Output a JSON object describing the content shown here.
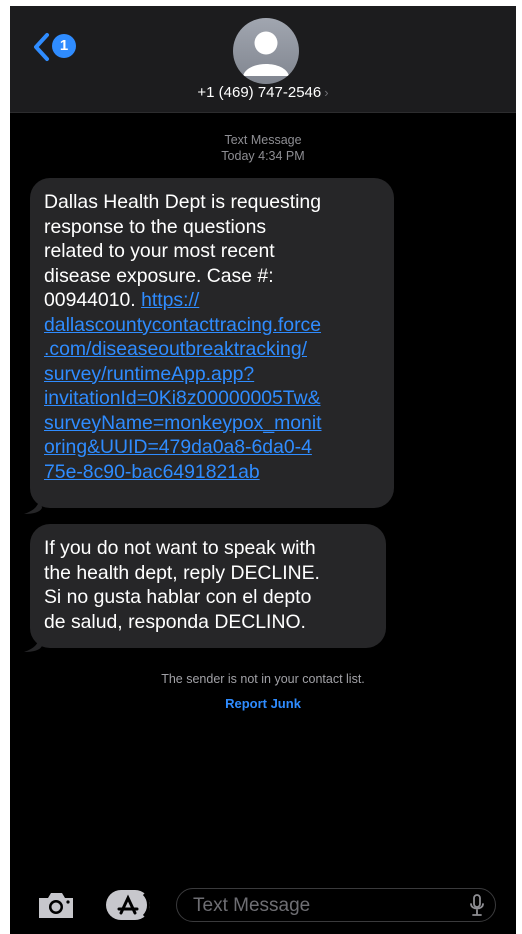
{
  "header": {
    "unread_count": "1",
    "contact_number": "+1 (469) 747-2546",
    "contact_chevron": "›"
  },
  "timestamp": {
    "service": "Text Message",
    "time": "Today 4:34 PM"
  },
  "messages": [
    {
      "text_lines": [
        "Dallas Health Dept is requesting",
        "response to the questions",
        "related to your most recent",
        "disease exposure. Case #:"
      ],
      "case_prefix": "00944010. ",
      "link_lines": [
        "https://",
        "dallascountycontacttracing.force",
        ".com/diseaseoutbreaktracking/",
        "survey/runtimeApp.app?",
        "invitationId=0Ki8z00000005Tw&",
        "surveyName=monkeypox_monit",
        "oring&UUID=479da0a8-6da0-4",
        "75e-8c90-bac6491821ab"
      ]
    },
    {
      "text_lines": [
        "If you do not want to speak with",
        "the health dept, reply DECLINE.",
        "Si no gusta hablar con el depto",
        "de salud, responda DECLINO."
      ]
    }
  ],
  "notice": "The sender is not in your contact list.",
  "report_junk": "Report Junk",
  "composer": {
    "placeholder": "Text Message"
  },
  "icons": [
    "back-chevron-icon",
    "contact-avatar-icon",
    "camera-icon",
    "app-store-icon",
    "microphone-icon"
  ],
  "colors": {
    "accent": "#2f8cff",
    "bubble": "#262628",
    "background": "#000000"
  }
}
